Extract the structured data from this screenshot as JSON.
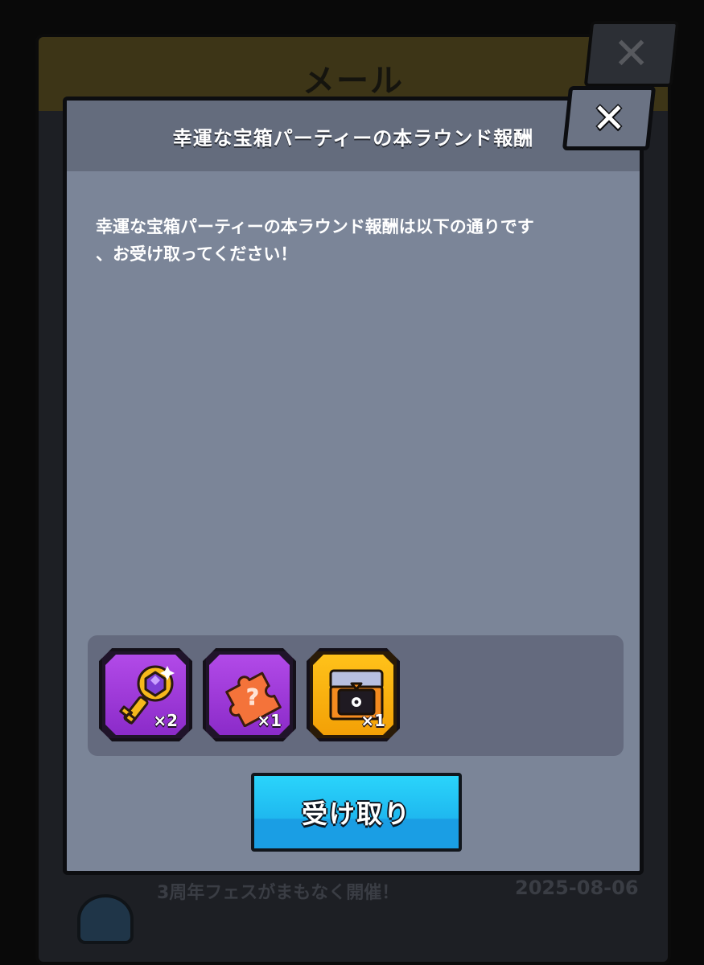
{
  "background": {
    "window_title": "メール",
    "close_symbol": "✕",
    "mail_subject": "3周年フェスがまもなく開催！",
    "mail_date": "2025-08-06"
  },
  "modal": {
    "title": "幸運な宝箱パーティーの本ラウンド報酬",
    "close_symbol": "✕",
    "body_line1": "幸運な宝箱パーティーの本ラウンド報酬は以下の通りです",
    "body_line2": "、お受け取ってください！",
    "rewards": [
      {
        "icon": "key-icon",
        "quantity": "×2",
        "frame_color": "#a83ee0"
      },
      {
        "icon": "puzzle-piece-icon",
        "quantity": "×1",
        "frame_color": "#a83ee0"
      },
      {
        "icon": "treasure-chest-icon",
        "quantity": "×1",
        "frame_color": "#f7b10f"
      }
    ],
    "claim_label": "受け取り"
  },
  "colors": {
    "modal_bg": "#7b8598",
    "modal_header": "#646c7d",
    "claim_button": "#1fb8ef",
    "reward_purple": "#a83ee0",
    "reward_gold": "#f7b10f"
  }
}
